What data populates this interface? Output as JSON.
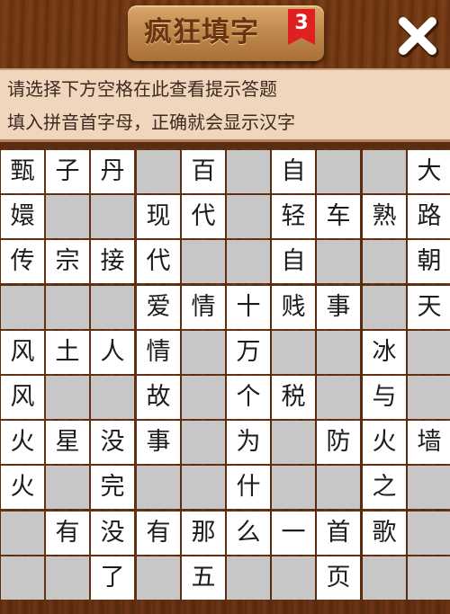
{
  "header": {
    "title": "疯狂填字",
    "level": "3",
    "close_icon": "close-icon"
  },
  "hints": {
    "line1": "请选择下方空格在此查看提示答题",
    "line2": "填入拼音首字母，正确就会显示汉字"
  },
  "grid": {
    "rows": [
      [
        "甄",
        "子",
        "丹",
        "",
        "百",
        "",
        "自",
        "",
        "",
        "大"
      ],
      [
        "嬛",
        "",
        "",
        "现",
        "代",
        "",
        "轻",
        "车",
        "熟",
        "路"
      ],
      [
        "传",
        "宗",
        "接",
        "代",
        "",
        "",
        "自",
        "",
        "",
        "朝"
      ],
      [
        "",
        "",
        "",
        "爱",
        "情",
        "十",
        "贱",
        "事",
        "",
        "天"
      ],
      [
        "风",
        "土",
        "人",
        "情",
        "",
        "万",
        "",
        "",
        "冰",
        ""
      ],
      [
        "风",
        "",
        "",
        "故",
        "",
        "个",
        "税",
        "",
        "与",
        ""
      ],
      [
        "火",
        "星",
        "没",
        "事",
        "",
        "为",
        "",
        "防",
        "火",
        "墙"
      ],
      [
        "火",
        "",
        "完",
        "",
        "",
        "什",
        "",
        "",
        "之",
        ""
      ],
      [
        "",
        "有",
        "没",
        "有",
        "那",
        "么",
        "一",
        "首",
        "歌",
        ""
      ],
      [
        "",
        "",
        "了",
        "",
        "五",
        "",
        "",
        "页",
        "",
        ""
      ]
    ],
    "mask": [
      [
        1,
        1,
        1,
        0,
        1,
        0,
        1,
        0,
        0,
        1
      ],
      [
        1,
        0,
        0,
        1,
        1,
        0,
        1,
        1,
        1,
        1
      ],
      [
        1,
        1,
        1,
        1,
        0,
        0,
        1,
        0,
        0,
        1
      ],
      [
        0,
        0,
        0,
        1,
        1,
        1,
        1,
        1,
        0,
        1
      ],
      [
        1,
        1,
        1,
        1,
        0,
        1,
        0,
        0,
        1,
        0
      ],
      [
        1,
        0,
        0,
        1,
        0,
        1,
        1,
        0,
        1,
        0
      ],
      [
        1,
        1,
        1,
        1,
        0,
        1,
        0,
        1,
        1,
        1
      ],
      [
        1,
        0,
        1,
        0,
        0,
        1,
        0,
        0,
        1,
        0
      ],
      [
        0,
        1,
        1,
        1,
        1,
        1,
        1,
        1,
        1,
        0
      ],
      [
        0,
        0,
        1,
        0,
        1,
        0,
        0,
        1,
        0,
        0
      ]
    ]
  }
}
